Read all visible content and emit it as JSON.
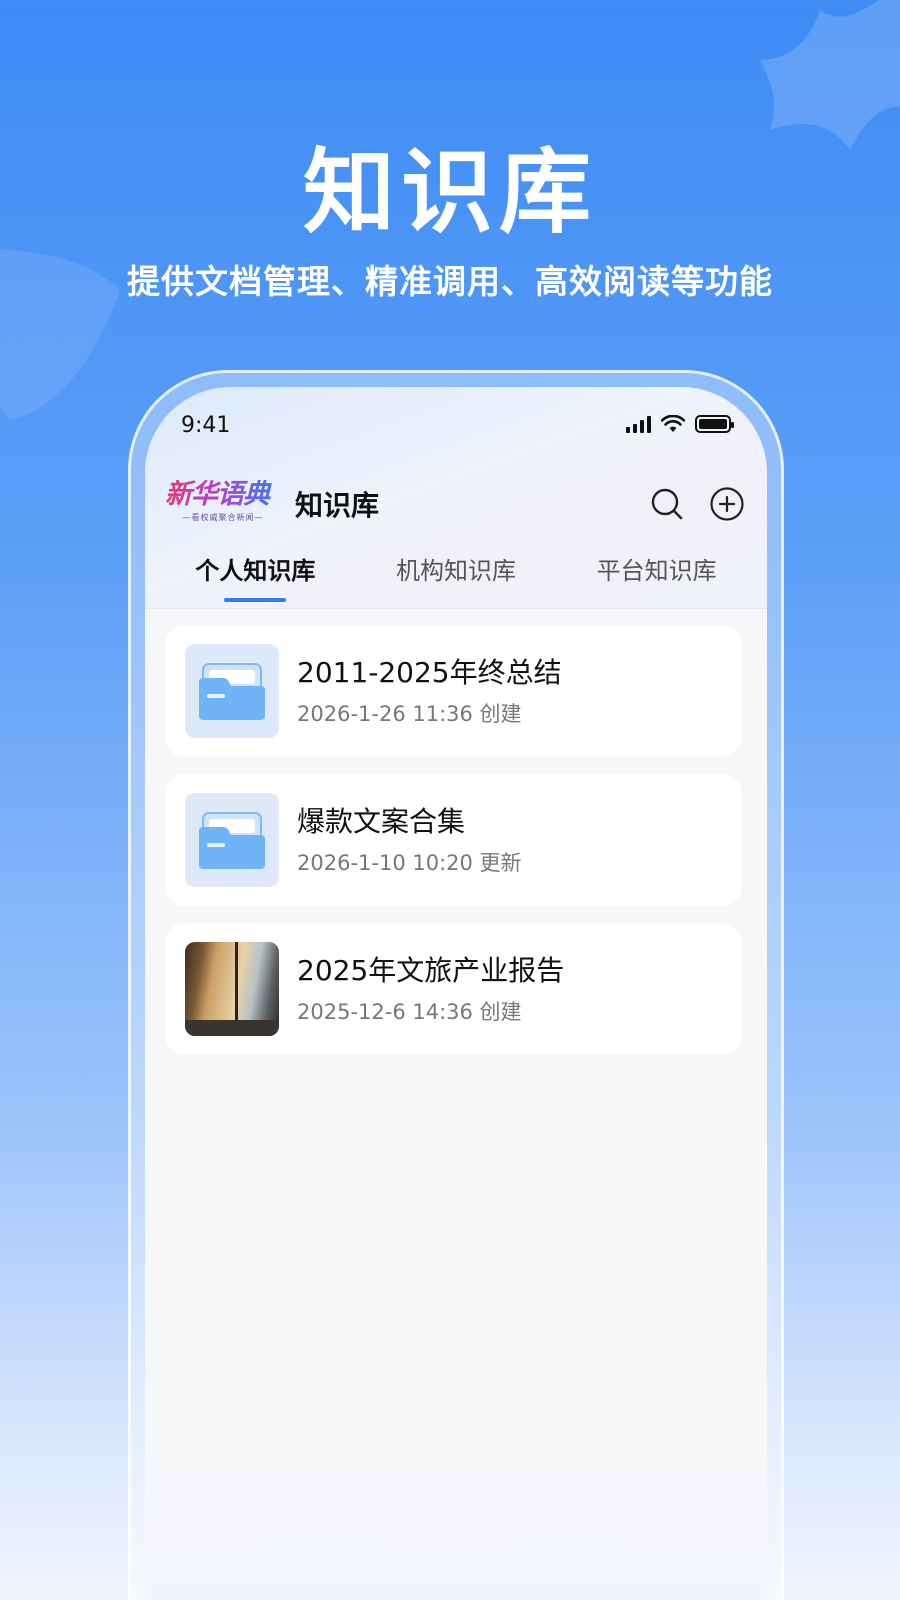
{
  "hero": {
    "title": "知识库",
    "subtitle": "提供文档管理、精准调用、高效阅读等功能"
  },
  "status_bar": {
    "time": "9:41"
  },
  "header": {
    "logo_text": "新华语典",
    "logo_tagline": "—看权威聚合新闻—",
    "title": "知识库",
    "search_icon": "search-icon",
    "add_icon": "plus-circle-icon"
  },
  "tabs": [
    {
      "label": "个人知识库",
      "active": true
    },
    {
      "label": "机构知识库",
      "active": false
    },
    {
      "label": "平台知识库",
      "active": false
    }
  ],
  "items": [
    {
      "title": "2011-2025年终总结",
      "meta": "2026-1-26 11:36 创建",
      "thumb": "folder-icon"
    },
    {
      "title": "爆款文案合集",
      "meta": "2026-1-10 10:20 更新",
      "thumb": "folder-icon"
    },
    {
      "title": "2025年文旅产业报告",
      "meta": "2025-12-6 14:36 创建",
      "thumb": "photo-thumbnail"
    }
  ],
  "colors": {
    "accent": "#2f7ef3",
    "background": "#3f8cf6",
    "folder": "#6fb4f7"
  }
}
